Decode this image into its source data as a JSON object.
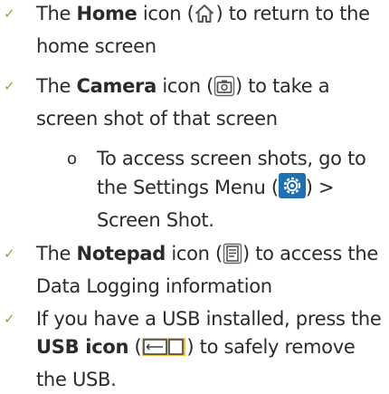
{
  "items": [
    {
      "t1": "The ",
      "bold": "Home",
      "t2": " icon (",
      "icon": "home-icon",
      "t3": ") to return to the home screen"
    },
    {
      "t1": "The ",
      "bold": "Camera",
      "t2": " icon (",
      "icon": "camera-icon",
      "t3": ") to take a screen shot of that screen"
    },
    {
      "t1": "To access screen shots, go to the Settings Menu (",
      "icon": "settings-icon",
      "t3": ") > Screen Shot."
    },
    {
      "t1": "The ",
      "bold": "Notepad",
      "t2": " icon (",
      "icon": "notepad-icon",
      "t3": ") to access the Data Logging information"
    },
    {
      "t1": "If you have a USB installed, press the ",
      "bold": "USB icon",
      "t2": " (",
      "icon": "usb-icon",
      "t3": ") to safely remove the USB."
    }
  ],
  "check_glyph": "✓",
  "sub_bullet_glyph": "o",
  "colors": {
    "check": "#7fa84a",
    "settings_icon_bg": "#1f6fb5",
    "icon_stroke": "#555555",
    "usb_icon_bg": "#f5c040"
  }
}
